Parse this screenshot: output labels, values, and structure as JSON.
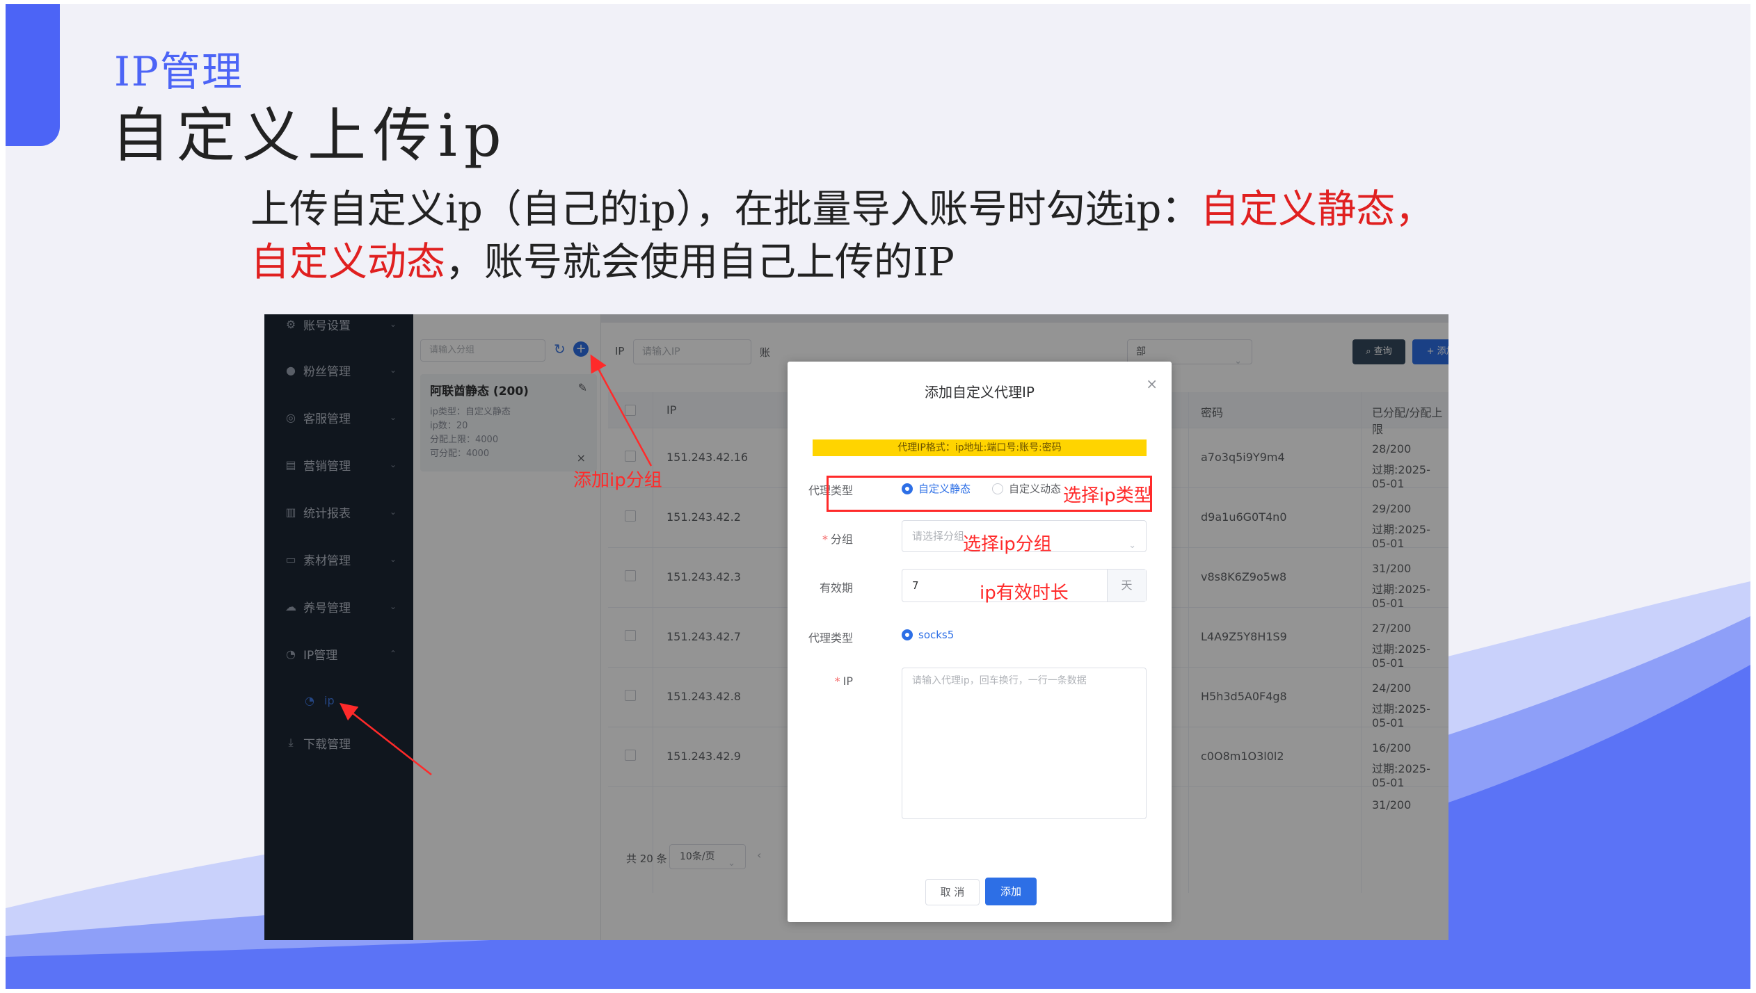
{
  "slide": {
    "kicker": "IP管理",
    "title": "自定义上传ip",
    "body_part1": "上传自定义ip（自己的ip），在批量导入账号时勾选ip：",
    "body_red1": "自定义静态，",
    "body_red2": "自定义动态",
    "body_part2": "，账号就会使用自己上传的IP"
  },
  "colors": {
    "accent": "#4c64f6",
    "annotation": "#ff2a2a",
    "primary": "#2d6fe6",
    "sidebar": "#1d2735"
  },
  "sidebar": {
    "items": [
      {
        "label": "账号设置",
        "icon": "gear-icon"
      },
      {
        "label": "粉丝管理",
        "icon": "user-icon"
      },
      {
        "label": "客服管理",
        "icon": "headset-icon"
      },
      {
        "label": "营销管理",
        "icon": "document-icon"
      },
      {
        "label": "统计报表",
        "icon": "bar-chart-icon"
      },
      {
        "label": "素材管理",
        "icon": "folder-icon"
      },
      {
        "label": "养号管理",
        "icon": "cloud-icon"
      },
      {
        "label": "IP管理",
        "icon": "compass-icon"
      },
      {
        "label": "下载管理",
        "icon": "download-icon"
      }
    ],
    "sub_item": "ip"
  },
  "group_panel": {
    "search_placeholder": "请输入分组",
    "group": {
      "name": "阿联酋静态 (200)",
      "type": "ip类型：自定义静态",
      "count": "ip数：20",
      "limit": "分配上限：4000",
      "available": "可分配：4000"
    }
  },
  "filter": {
    "ip_label": "IP",
    "ip_placeholder": "请输入IP",
    "account_label": "账",
    "select_tail": "部",
    "query_button": "查询",
    "add_proxy_button": "+ 添加代理IP"
  },
  "table": {
    "headers": {
      "ip": "IP",
      "password": "密码",
      "alloc": "已分配/分配上限"
    },
    "rows": [
      {
        "ip": "151.243.42.16",
        "password": "a7o3q5i9Y9m4",
        "alloc": "28/200",
        "expire": "过期:2025-05-01"
      },
      {
        "ip": "151.243.42.2",
        "password": "d9a1u6G0T4n0",
        "alloc": "29/200",
        "expire": "过期:2025-05-01"
      },
      {
        "ip": "151.243.42.3",
        "password": "v8s8K6Z9o5w8",
        "alloc": "31/200",
        "expire": "过期:2025-05-01"
      },
      {
        "ip": "151.243.42.7",
        "password": "L4A9Z5Y8H1S9",
        "alloc": "27/200",
        "expire": "过期:2025-05-01"
      },
      {
        "ip": "151.243.42.8",
        "password": "H5h3d5A0F4g8",
        "alloc": "24/200",
        "expire": "过期:2025-05-01"
      },
      {
        "ip": "151.243.42.9",
        "password": "c0O8m1O3l0l2",
        "alloc": "16/200",
        "expire": "过期:2025-05-01"
      }
    ],
    "partial_alloc": "31/200"
  },
  "pager": {
    "total": "共 20 条",
    "size": "10条/页"
  },
  "dialog": {
    "title": "添加自定义代理IP",
    "format_hint": "代理IP格式：ip地址:端口号:账号:密码",
    "proxy_type_label": "代理类型",
    "option_static": "自定义静态",
    "option_dynamic": "自定义动态",
    "group_label": "分组",
    "group_placeholder": "请选择分组",
    "validity_label": "有效期",
    "validity_value": "7",
    "validity_unit": "天",
    "protocol_label": "代理类型",
    "protocol_value": "socks5",
    "ip_label": "IP",
    "ip_placeholder": "请输入代理ip，回车换行，一行一条数据",
    "cancel": "取 消",
    "confirm": "添加"
  },
  "annotations": {
    "add_group": "添加ip分组",
    "select_type": "选择ip类型",
    "select_group": "选择ip分组",
    "validity": "ip有效时长"
  }
}
